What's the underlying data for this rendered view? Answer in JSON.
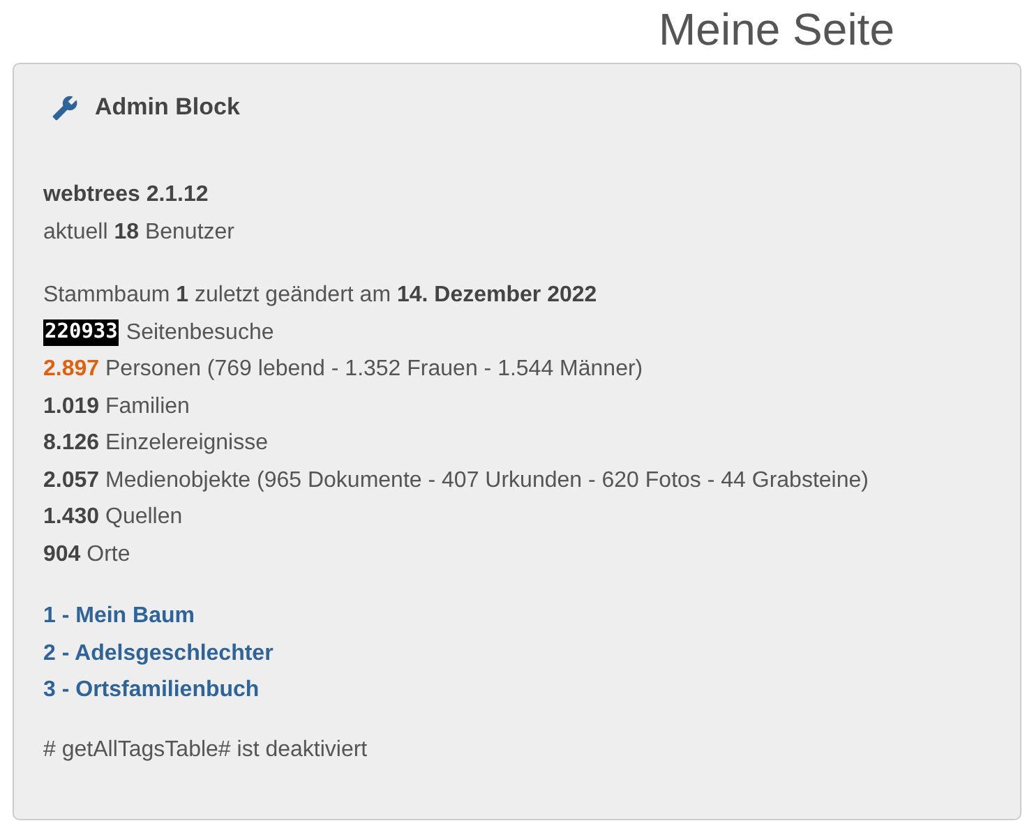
{
  "page_title": "Meine Seite",
  "block": {
    "title": "Admin Block",
    "version": "webtrees 2.1.12",
    "users": "aktuell **18** Benutzer",
    "tree_changed": "Stammbaum **1** zuletzt geändert am **14. Dezember 2022**",
    "hit_counter": {
      "count": "220933",
      "label": "Seitenbesuche"
    },
    "stats": [
      {
        "count": "2.897",
        "text": "Personen (769 lebend - 1.352 Frauen - 1.544 Männer)",
        "highlighted": true
      },
      {
        "count": "1.019",
        "text": "Familien",
        "highlighted": false
      },
      {
        "count": "8.126",
        "text": "Einzelereignisse",
        "highlighted": false
      },
      {
        "count": "2.057",
        "text": "Medienobjekte (965 Dokumente - 407 Urkunden - 620 Fotos - 44 Grabsteine)",
        "highlighted": false
      },
      {
        "count": "1.430",
        "text": "Quellen",
        "highlighted": false
      },
      {
        "count": "904",
        "text": "Orte",
        "highlighted": false
      }
    ],
    "tree_links": [
      {
        "label": "1 - Mein Baum"
      },
      {
        "label": "2 - Adelsgeschlechter"
      },
      {
        "label": "3 - Ortsfamilienbuch"
      }
    ],
    "notice": "# getAllTagsTable# ist deaktiviert"
  }
}
